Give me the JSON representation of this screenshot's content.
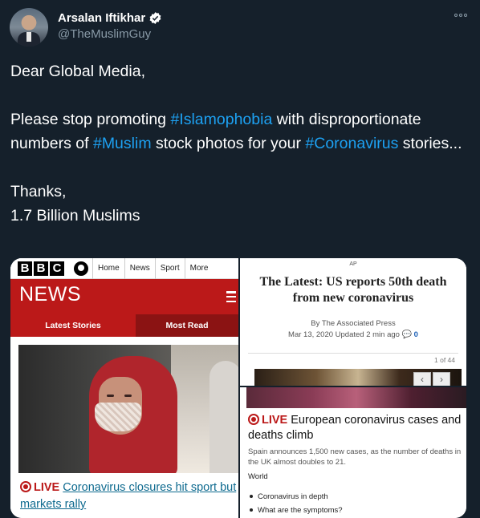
{
  "tweet": {
    "author": {
      "display_name": "Arsalan Iftikhar",
      "handle": "@TheMuslimGuy",
      "verified_icon": "verified-badge-icon",
      "more_icon": "more-options-icon"
    },
    "text": {
      "line1": "Dear Global Media,",
      "para2_part1": "Please stop promoting ",
      "hashtag1": "#Islamophobia",
      "para2_part2": " with disproportionate numbers of ",
      "hashtag2": "#Muslim",
      "para2_part3": " stock photos for your ",
      "hashtag3": "#Coronavirus",
      "para2_part4": " stories...",
      "signoff1": "Thanks,",
      "signoff2": "1.7 Billion Muslims"
    },
    "colors": {
      "background": "#15202b",
      "text": "#ffffff",
      "secondary": "#8899a6",
      "link": "#1da1f2",
      "bbc_red": "#bb1919"
    }
  },
  "media": {
    "bbc_panel": {
      "logo_letters": [
        "B",
        "B",
        "C"
      ],
      "nav_items": [
        "Home",
        "News",
        "Sport",
        "More"
      ],
      "section_title": "NEWS",
      "tabs": [
        "Latest Stories",
        "Most Read"
      ],
      "live_label": "LIVE",
      "headline": "Coronavirus closures hit sport but markets rally"
    },
    "ap_panel": {
      "logo": "AP",
      "title": "The Latest: US reports 50th death from new coronavirus",
      "byline": "By The Associated Press",
      "meta": "Mar 13, 2020 Updated 2 min ago",
      "comments": "0",
      "pager": "1 of 44",
      "prev": "‹",
      "next": "›"
    },
    "bbc_live_panel": {
      "live_label": "LIVE",
      "headline": "European coronavirus cases and deaths climb",
      "summary": "Spain announces 1,500 new cases, as the number of deaths in the UK almost doubles to 21.",
      "tag": "World",
      "links": [
        "Coronavirus in depth",
        "What are the symptoms?"
      ]
    }
  }
}
